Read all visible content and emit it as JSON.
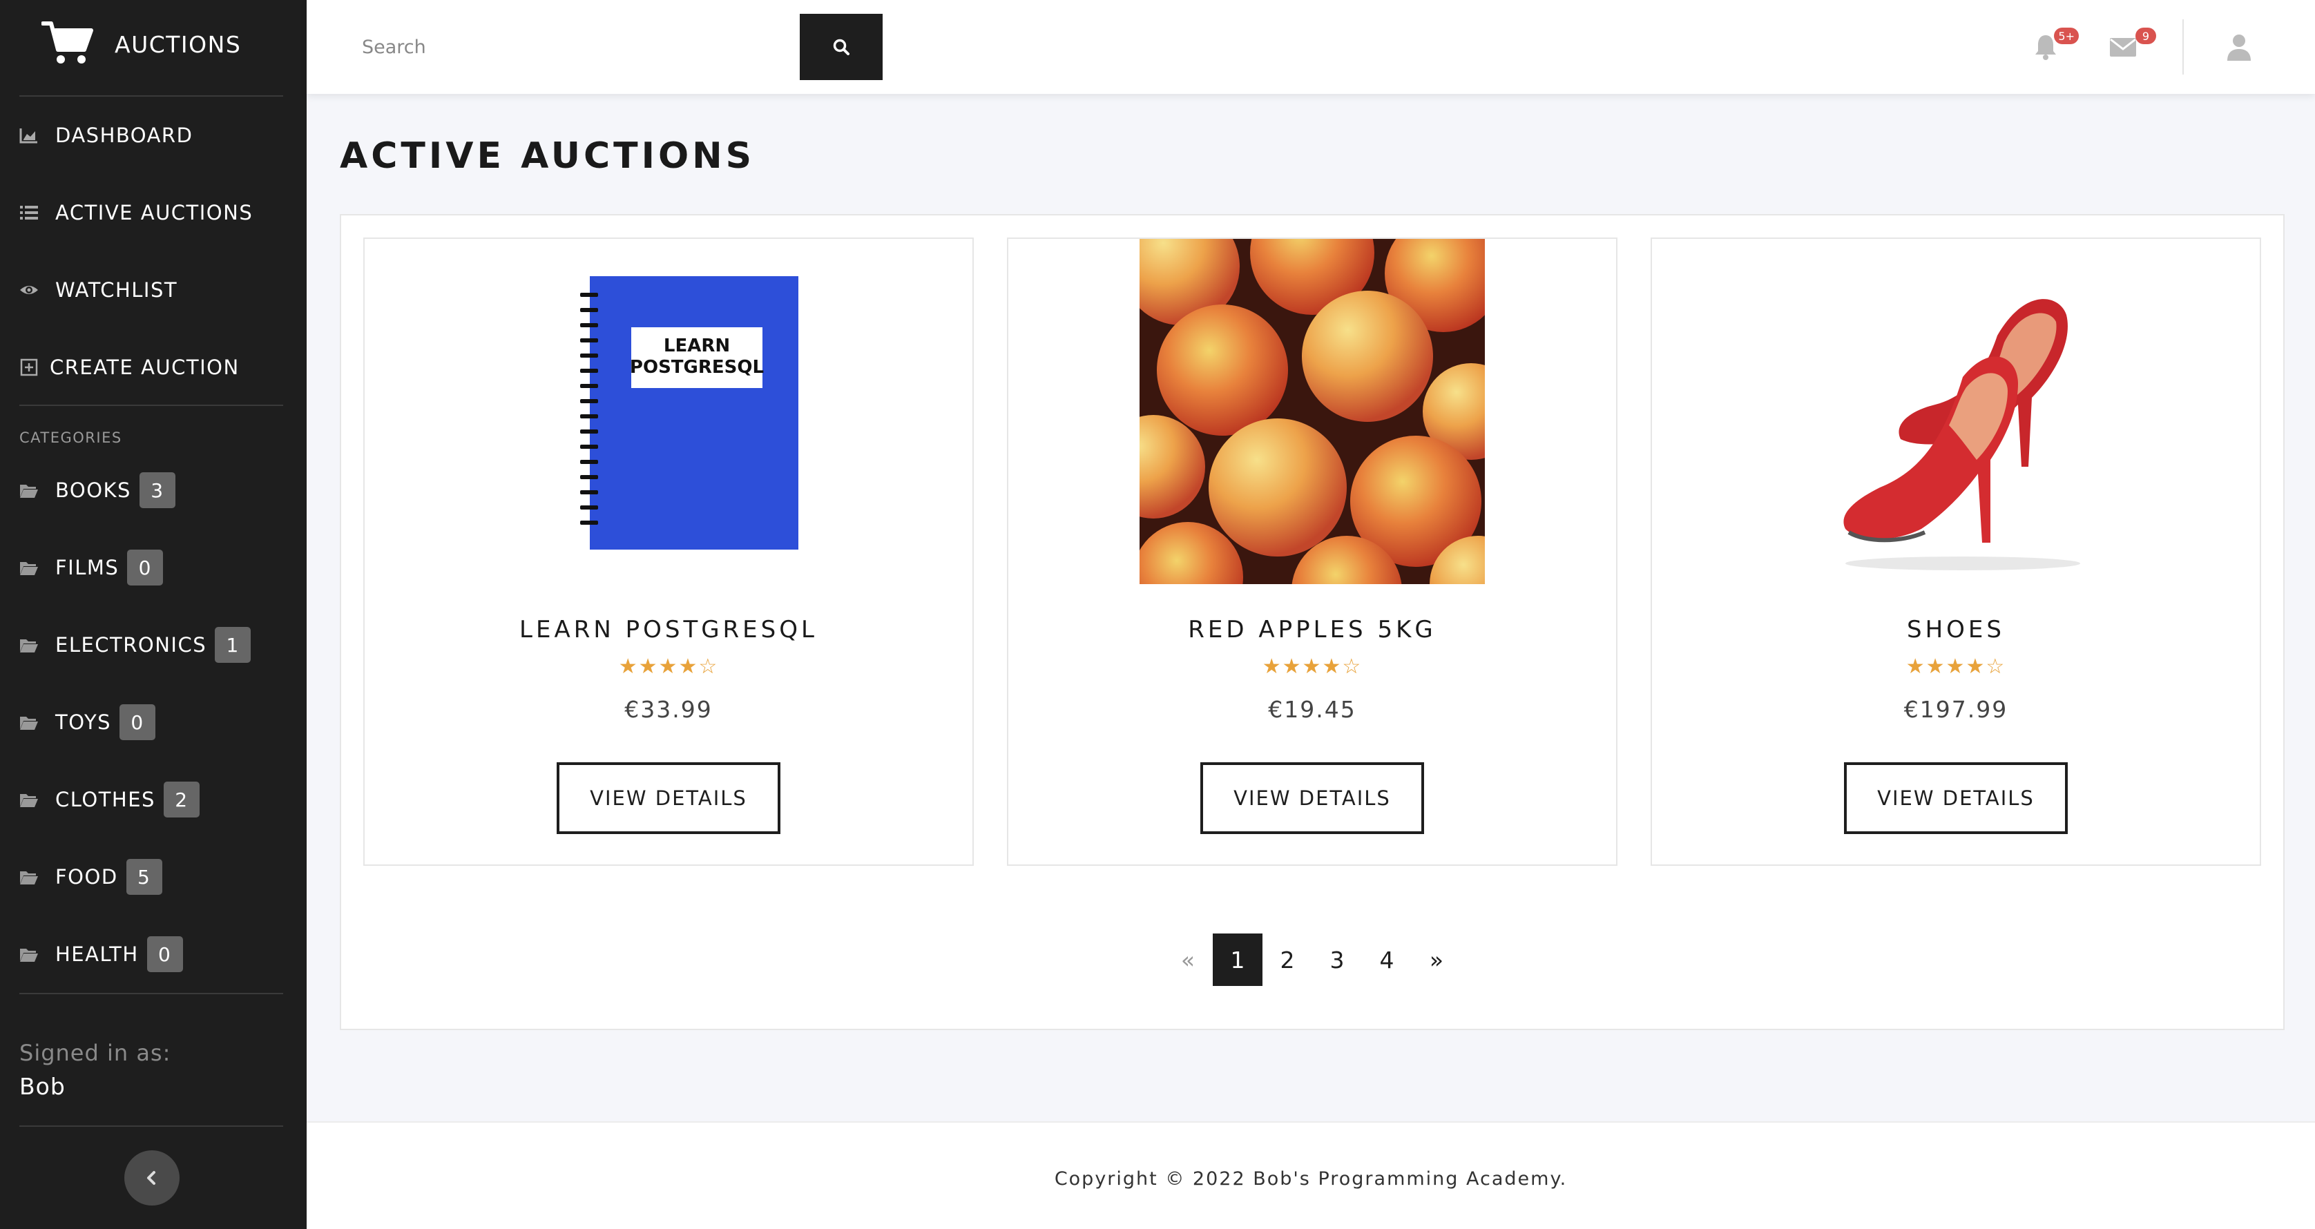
{
  "app": {
    "brand": "AUCTIONS"
  },
  "sidebar": {
    "nav": [
      {
        "label": "DASHBOARD",
        "icon": "chart-icon"
      },
      {
        "label": "ACTIVE AUCTIONS",
        "icon": "list-icon"
      },
      {
        "label": "WATCHLIST",
        "icon": "eye-icon"
      },
      {
        "label": "CREATE AUCTION",
        "icon": "plus-square-icon"
      }
    ],
    "categories_heading": "CATEGORIES",
    "categories": [
      {
        "label": "BOOKS",
        "count": "3"
      },
      {
        "label": "FILMS",
        "count": "0"
      },
      {
        "label": "ELECTRONICS",
        "count": "1"
      },
      {
        "label": "TOYS",
        "count": "0"
      },
      {
        "label": "CLOTHES",
        "count": "2"
      },
      {
        "label": "FOOD",
        "count": "5"
      },
      {
        "label": "HEALTH",
        "count": "0"
      }
    ],
    "signed_in_label": "Signed in as:",
    "signed_in_user": "Bob"
  },
  "topbar": {
    "search_placeholder": "Search",
    "notifications_badge": "5+",
    "messages_badge": "9"
  },
  "main": {
    "title": "ACTIVE AUCTIONS",
    "cards": [
      {
        "title": "LEARN POSTGRESQL",
        "price": "€33.99",
        "rating": 4,
        "rating_max": 5,
        "button": "VIEW DETAILS",
        "book_cover_text_1": "LEARN",
        "book_cover_text_2": "POSTGRESQL"
      },
      {
        "title": "RED APPLES 5KG",
        "price": "€19.45",
        "rating": 4,
        "rating_max": 5,
        "button": "VIEW DETAILS"
      },
      {
        "title": "SHOES",
        "price": "€197.99",
        "rating": 4,
        "rating_max": 5,
        "button": "VIEW DETAILS"
      }
    ],
    "pagination": {
      "prev": "«",
      "pages": [
        "1",
        "2",
        "3",
        "4"
      ],
      "current": "1",
      "next": "»"
    }
  },
  "footer": {
    "text": "Copyright © 2022 Bob's Programming Academy."
  },
  "colors": {
    "sidebar_bg": "#1e1e1e",
    "page_bg": "#f5f6fa",
    "star": "#e8a23a",
    "badge_red": "#d9534f",
    "book_blue": "#2d4fd9"
  }
}
